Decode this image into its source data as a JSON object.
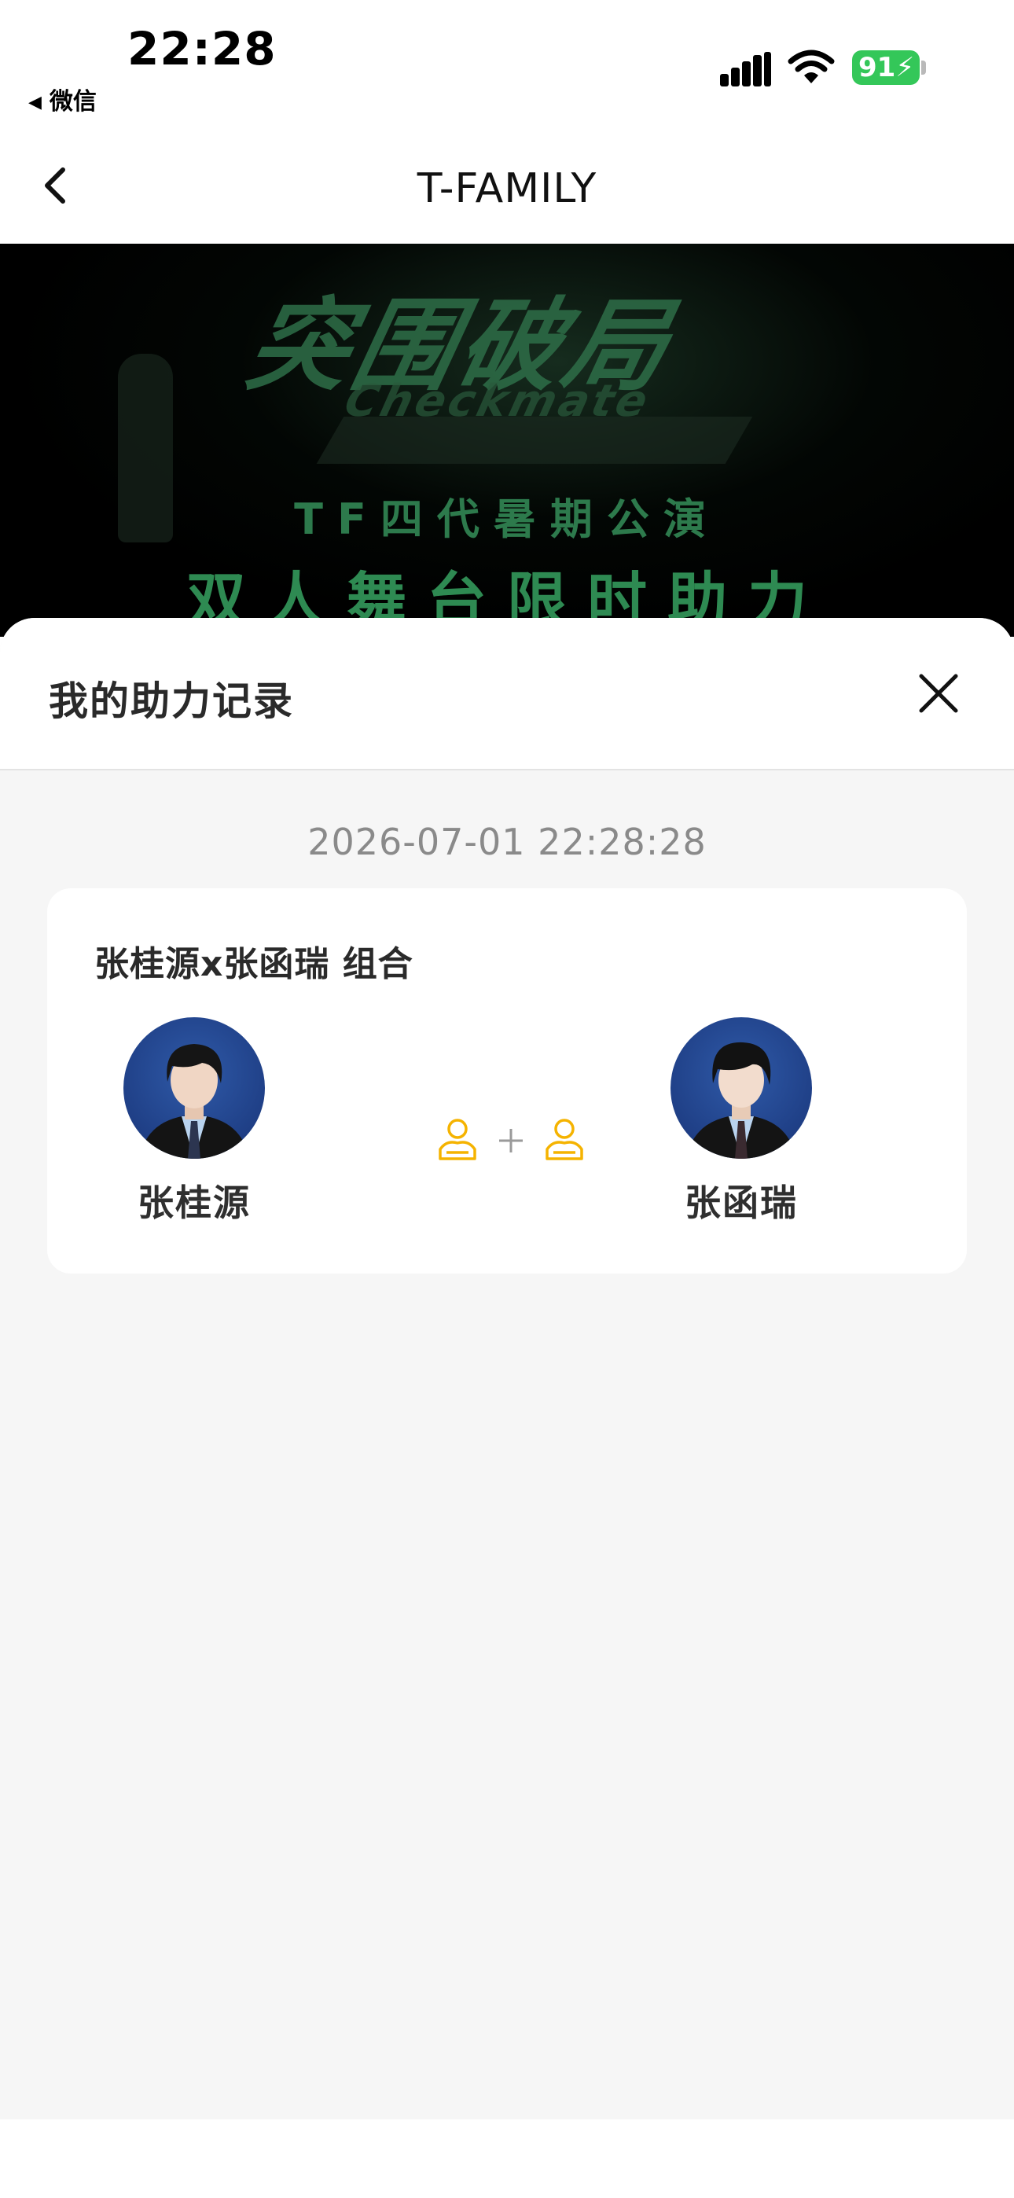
{
  "status_bar": {
    "time": "22:28",
    "back_app": "微信",
    "battery": "91"
  },
  "nav": {
    "title": "T-FAMILY"
  },
  "banner": {
    "art_title": "突围破局",
    "art_subtitle": "Checkmate",
    "line1": "TF四代暑期公演",
    "line2": "双人舞台限时助力"
  },
  "sheet": {
    "title": "我的助力记录",
    "record_time": "2026-07-01 22:28:28",
    "record": {
      "group_title": "张桂源x张函瑞 组合",
      "members": [
        {
          "name": "张桂源"
        },
        {
          "name": "张函瑞"
        }
      ]
    }
  },
  "colors": {
    "accent": "#f5b300",
    "battery_green": "#34c759",
    "sheet_bg": "#f6f6f6"
  },
  "icons": {
    "back": "chevron-left-icon",
    "close": "close-icon",
    "pair": "person-plus-person-icon"
  }
}
